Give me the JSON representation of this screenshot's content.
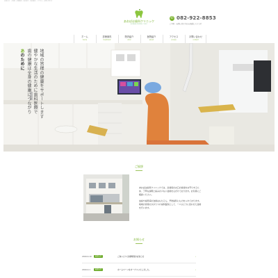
{
  "header": {
    "topline": "お知らせ · ご挨拶 · 診療案内 · 院内紹介 · 医院案内 · アクセス · お問い合わせ",
    "logo_name": "あおばは歯科クリニック",
    "logo_sub": "AOBAHA DENTAL CLINIC",
    "tel": "082-922-8853",
    "tel_note": "ご予約・お問い合わせは お電話にてどうぞ"
  },
  "nav": [
    {
      "jp": "ホーム",
      "en": "home"
    },
    {
      "jp": "診療案内",
      "en": "treatment"
    },
    {
      "jp": "院内紹介",
      "en": "clinic"
    },
    {
      "jp": "医院紹介",
      "en": "about"
    },
    {
      "jp": "アクセス",
      "en": "access"
    },
    {
      "jp": "お問い合わせ",
      "en": "contact"
    }
  ],
  "hero": {
    "lead_em": "あ",
    "lead": "のために",
    "lines": [
      "歯の健康は全身の健康につながり",
      "健やかな生活のために歯科医療で",
      "地域の皆様の健康をサポートします"
    ]
  },
  "greeting": {
    "title": "ご挨拶",
    "paragraphs": [
      "あおばは歯科クリニックでは、患者様のお口の健康をお守りするため、丁寧な説明と痛みの少ない治療を心がけております。お気軽にご相談ください。",
      "虫歯や歯周病の治療はもちろん、予防歯科にも力を入れております。地域の皆様のかかりつけ歯科医院として、一人ひとりに合わせた治療を行います。"
    ]
  },
  "news": {
    "title": "お知らせ",
    "items": [
      {
        "date": "2019.4.10",
        "badge": "お知らせ",
        "title": "ごあいさつ 診療時間のお知らせ"
      },
      {
        "date": "2019.4.1",
        "badge": "お知らせ",
        "title": "ホームページをオープンいたしました。"
      }
    ]
  },
  "colors": {
    "accent": "#7ab32d",
    "badge": "#6dab2a",
    "chair": "#e0823c"
  }
}
